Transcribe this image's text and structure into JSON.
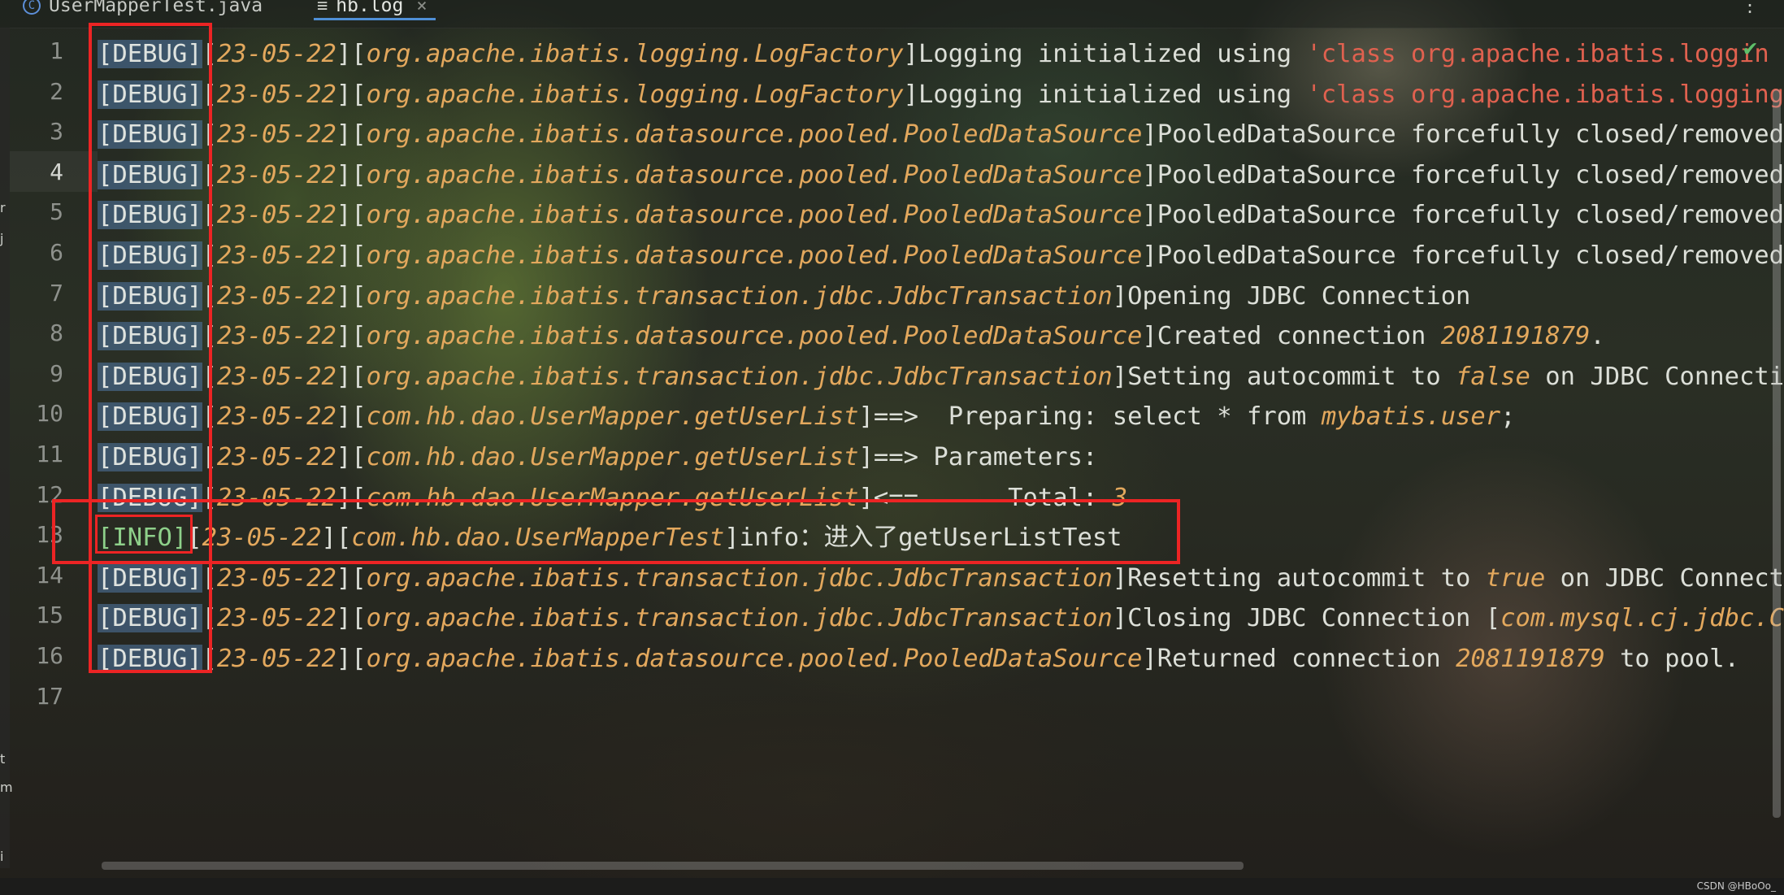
{
  "tabs": [
    {
      "label": "UserMapperTest.java",
      "icon": "class-icon"
    },
    {
      "label": "hb.log",
      "icon": "log-file-icon",
      "active": true
    }
  ],
  "tab_menu": "⋮",
  "editor": {
    "current_line": 4,
    "lines": [
      {
        "n": "1",
        "level": "[DEBUG]",
        "date": "23-05-22",
        "logger": "org.apache.ibatis.logging.LogFactory",
        "msg": "Logging initialized using ",
        "msg2": "'class org.apache.ibatis.loggin"
      },
      {
        "n": "2",
        "level": "[DEBUG]",
        "date": "23-05-22",
        "logger": "org.apache.ibatis.logging.LogFactory",
        "msg": "Logging initialized using ",
        "msg2": "'class org.apache.ibatis.logging.l"
      },
      {
        "n": "3",
        "level": "[DEBUG]",
        "date": "23-05-22",
        "logger": "org.apache.ibatis.datasource.pooled.PooledDataSource",
        "msg": "PooledDataSource forcefully closed/removed a"
      },
      {
        "n": "4",
        "level": "[DEBUG]",
        "date": "23-05-22",
        "logger": "org.apache.ibatis.datasource.pooled.PooledDataSource",
        "msg": "PooledDataSource forcefully closed/removed a"
      },
      {
        "n": "5",
        "level": "[DEBUG]",
        "date": "23-05-22",
        "logger": "org.apache.ibatis.datasource.pooled.PooledDataSource",
        "msg": "PooledDataSource forcefully closed/removed a"
      },
      {
        "n": "6",
        "level": "[DEBUG]",
        "date": "23-05-22",
        "logger": "org.apache.ibatis.datasource.pooled.PooledDataSource",
        "msg": "PooledDataSource forcefully closed/removed a"
      },
      {
        "n": "7",
        "level": "[DEBUG]",
        "date": "23-05-22",
        "logger": "org.apache.ibatis.transaction.jdbc.JdbcTransaction",
        "msg": "Opening JDBC Connection"
      },
      {
        "n": "8",
        "level": "[DEBUG]",
        "date": "23-05-22",
        "logger": "org.apache.ibatis.datasource.pooled.PooledDataSource",
        "msg": "Created connection ",
        "hl": "2081191879",
        "msg3": "."
      },
      {
        "n": "9",
        "level": "[DEBUG]",
        "date": "23-05-22",
        "logger": "org.apache.ibatis.transaction.jdbc.JdbcTransaction",
        "msg": "Setting autocommit to ",
        "hl": "false",
        "msg3": " on JDBC Connectior"
      },
      {
        "n": "10",
        "level": "[DEBUG]",
        "date": "23-05-22",
        "logger": "com.hb.dao.UserMapper.getUserList",
        "msg": "==>  Preparing: select * from ",
        "hl": "mybatis.user",
        "msg3": ";"
      },
      {
        "n": "11",
        "level": "[DEBUG]",
        "date": "23-05-22",
        "logger": "com.hb.dao.UserMapper.getUserList",
        "msg": "==> Parameters:"
      },
      {
        "n": "12",
        "level": "[DEBUG]",
        "date": "23-05-22",
        "logger": "com.hb.dao.UserMapper.getUserList",
        "msg": "<==      Total: ",
        "hl": "3"
      },
      {
        "n": "13",
        "level": "[INFO]",
        "date": "23-05-22",
        "logger": "com.hb.dao.UserMapperTest",
        "msg": "info：进入了getUserListTest"
      },
      {
        "n": "14",
        "level": "[DEBUG]",
        "date": "23-05-22",
        "logger": "org.apache.ibatis.transaction.jdbc.JdbcTransaction",
        "msg": "Resetting autocommit to ",
        "hl": "true",
        "msg3": " on JDBC Connectio"
      },
      {
        "n": "15",
        "level": "[DEBUG]",
        "date": "23-05-22",
        "logger": "org.apache.ibatis.transaction.jdbc.JdbcTransaction",
        "msg": "Closing JDBC Connection [",
        "hl": "com.mysql.cj.jdbc.Cor"
      },
      {
        "n": "16",
        "level": "[DEBUG]",
        "date": "23-05-22",
        "logger": "org.apache.ibatis.datasource.pooled.PooledDataSource",
        "msg": "Returned connection ",
        "hl": "2081191879",
        "msg3": " to pool."
      },
      {
        "n": "17"
      }
    ]
  },
  "left_strip_chars": [
    "r",
    "j",
    "t",
    "m",
    "i"
  ],
  "watermark": "CSDN @HBoOo_",
  "colors": {
    "accent_tab": "#4f8fd6",
    "annotation_box": "#ec2424",
    "level_info": "#8ed08a",
    "italic_highlight": "#e3a85d",
    "string_literal": "#e0614f"
  }
}
